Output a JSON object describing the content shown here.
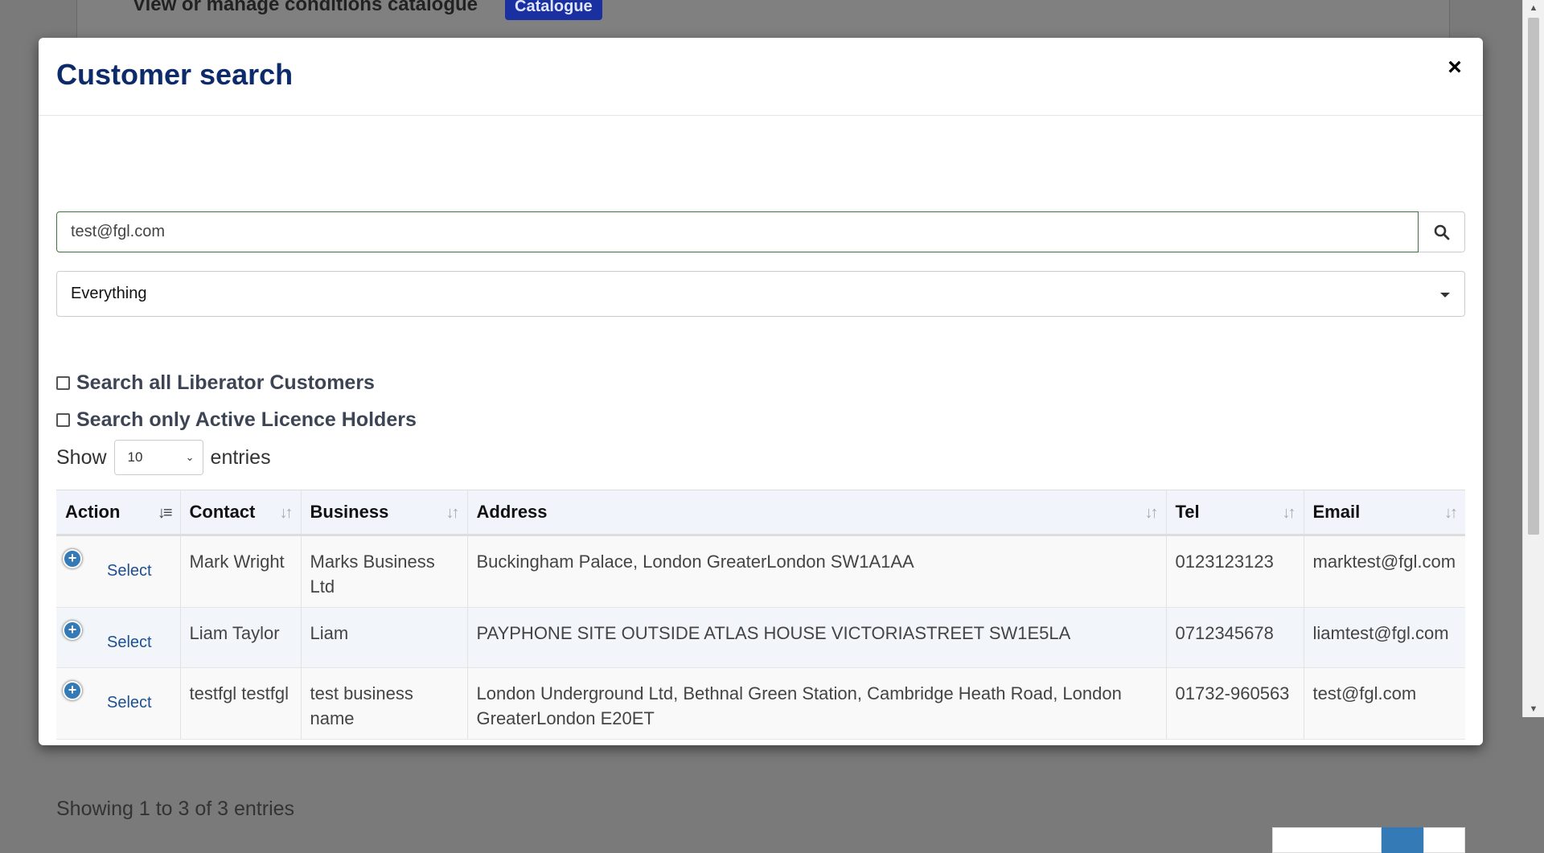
{
  "background": {
    "heading": "View or manage conditions catalogue",
    "catalogue_button": "Catalogue"
  },
  "modal": {
    "title": "Customer search",
    "close_label": "×"
  },
  "search": {
    "value": "test@fgl.com",
    "button_icon": "search-icon"
  },
  "filter": {
    "selected": "Everything"
  },
  "checkboxes": [
    {
      "label": "Search all Liberator Customers",
      "checked": false
    },
    {
      "label": "Search only Active Licence Holders",
      "checked": false
    }
  ],
  "length": {
    "show_label": "Show",
    "value": "10",
    "entries_label": "entries"
  },
  "table": {
    "columns": [
      "Action",
      "Contact",
      "Business",
      "Address",
      "Tel",
      "Email"
    ],
    "rows": [
      {
        "action": "Select",
        "contact": "Mark Wright",
        "business": "Marks Business Ltd",
        "address": "Buckingham Palace, London GreaterLondon SW1A1AA",
        "tel": "0123123123",
        "email": "marktest@fgl.com"
      },
      {
        "action": "Select",
        "contact": "Liam Taylor",
        "business": "Liam",
        "address": "PAYPHONE SITE OUTSIDE ATLAS HOUSE VICTORIASTREET SW1E5LA",
        "tel": "0712345678",
        "email": "liamtest@fgl.com"
      },
      {
        "action": "Select",
        "contact": "testfgl testfgl",
        "business": "test business name",
        "address": "London Underground Ltd, Bethnal Green Station, Cambridge Heath Road, London GreaterLondon E20ET",
        "tel": "01732-960563",
        "email": "test@fgl.com"
      }
    ]
  },
  "info": "Showing 1 to 3 of 3 entries",
  "colors": {
    "title": "#0d2a6b",
    "link": "#1d4f91",
    "accent": "#337ab7",
    "input_border": "#3c763d"
  }
}
